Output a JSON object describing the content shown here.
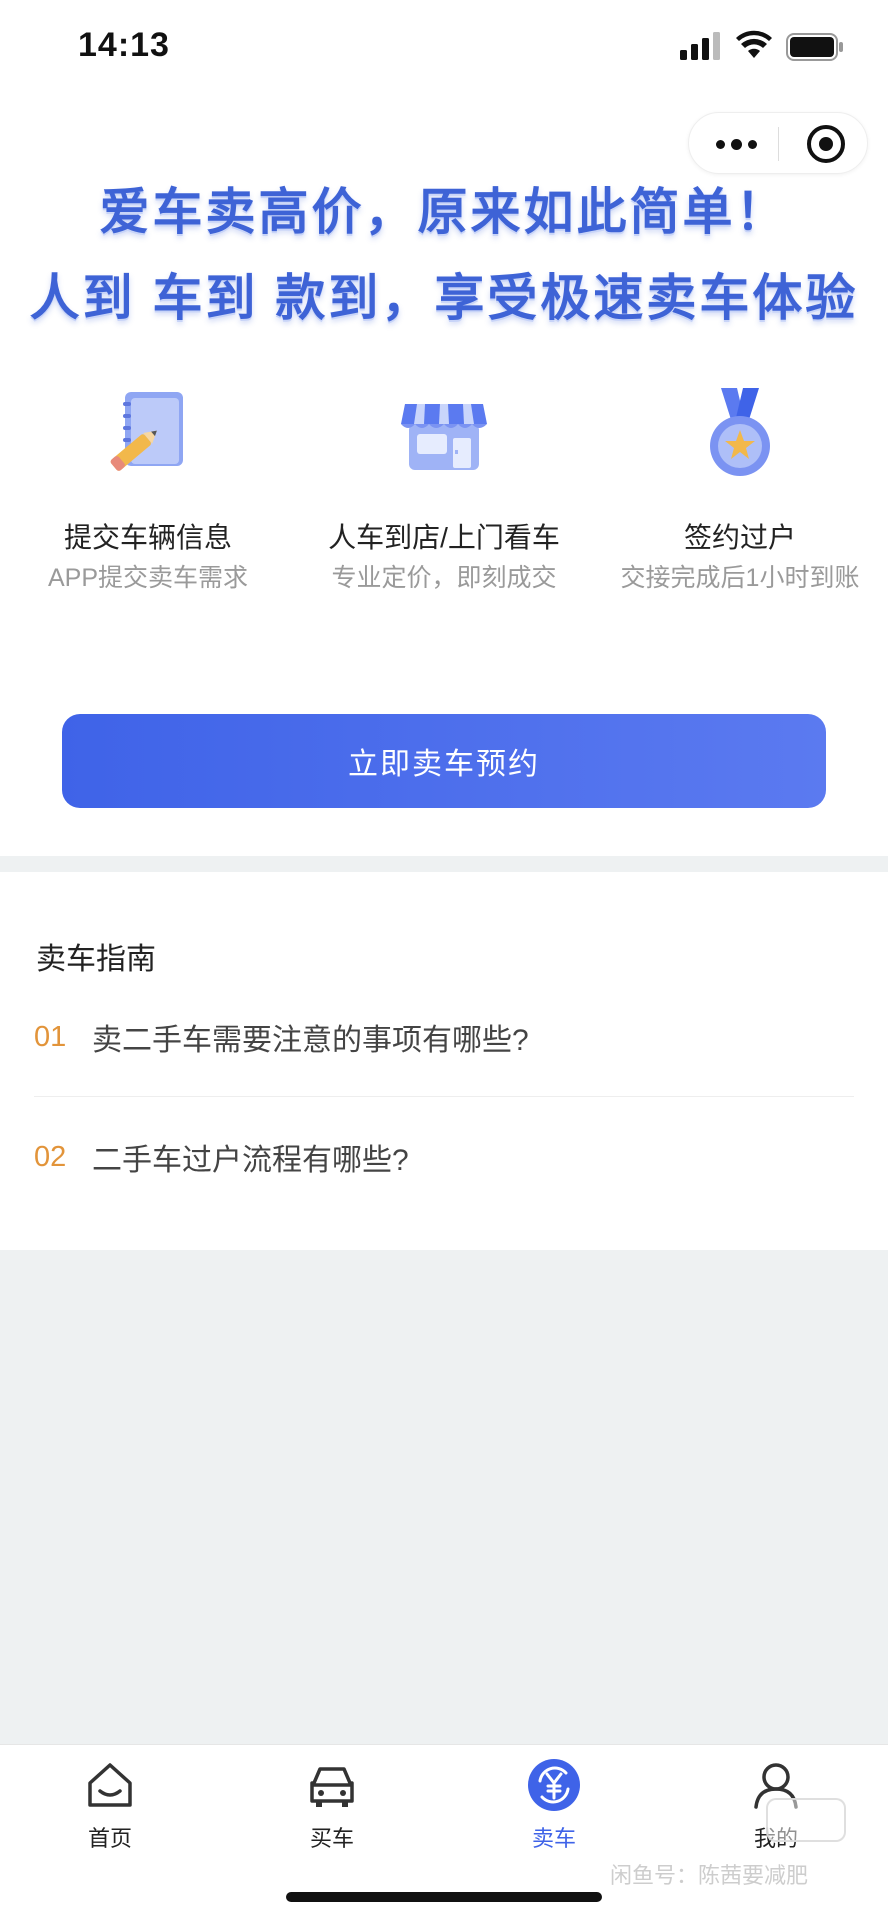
{
  "status_bar": {
    "time": "14:13"
  },
  "headline": {
    "line1": "爱车卖高价，原来如此简单！",
    "line2": "人到 车到 款到，享受极速卖车体验"
  },
  "steps": [
    {
      "title": "提交车辆信息",
      "subtitle": "APP提交卖车需求",
      "icon": "notebook-pencil-icon"
    },
    {
      "title": "人车到店/上门看车",
      "subtitle": "专业定价，即刻成交",
      "icon": "store-icon"
    },
    {
      "title": "签约过户",
      "subtitle": "交接完成后1小时到账",
      "icon": "medal-icon"
    }
  ],
  "cta": {
    "label": "立即卖车预约"
  },
  "guide": {
    "title": "卖车指南",
    "items": [
      {
        "num": "01",
        "text": "卖二手车需要注意的事项有哪些?"
      },
      {
        "num": "02",
        "text": "二手车过户流程有哪些?"
      }
    ]
  },
  "tabbar": {
    "items": [
      {
        "label": "首页",
        "icon": "home-icon"
      },
      {
        "label": "买车",
        "icon": "car-icon"
      },
      {
        "label": "卖车",
        "icon": "sell-yuan-icon",
        "active": true
      },
      {
        "label": "我的",
        "icon": "user-icon"
      }
    ]
  },
  "watermark": "闲鱼号：陈茜要减肥",
  "colors": {
    "accent": "#3f63e8",
    "number": "#e2943a",
    "subtext": "#9a9a9a",
    "background_gray": "#eef1f2"
  }
}
